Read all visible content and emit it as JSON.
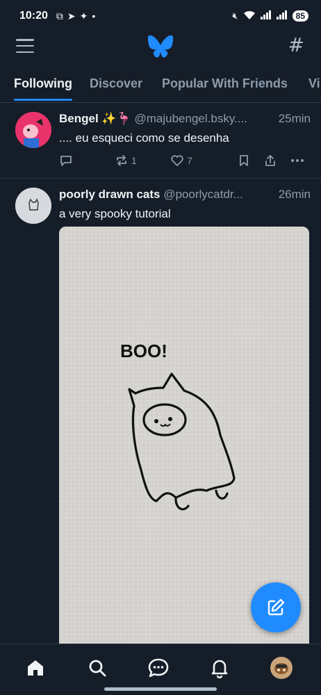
{
  "status_bar": {
    "time": "10:20",
    "battery": "85"
  },
  "app": {
    "logo": "bluesky-butterfly-icon",
    "accent": "#208bfe"
  },
  "tabs": [
    {
      "label": "Following",
      "active": true
    },
    {
      "label": "Discover",
      "active": false
    },
    {
      "label": "Popular With Friends",
      "active": false
    },
    {
      "label": "Vi",
      "active": false
    }
  ],
  "posts": [
    {
      "author": "Bengel ✨🦩",
      "handle": "@majubengel.bsky....",
      "time": "25min",
      "text": ".... eu esqueci como se desenha",
      "reposts": "1",
      "likes": "7"
    },
    {
      "author": "poorly drawn cats",
      "handle": "@poorlycatdr...",
      "time": "26min",
      "text": "a very spooky tutorial",
      "image_text": "BOO!"
    }
  ],
  "nav": [
    "home-icon",
    "search-icon",
    "chat-icon",
    "bell-icon",
    "profile-avatar"
  ]
}
